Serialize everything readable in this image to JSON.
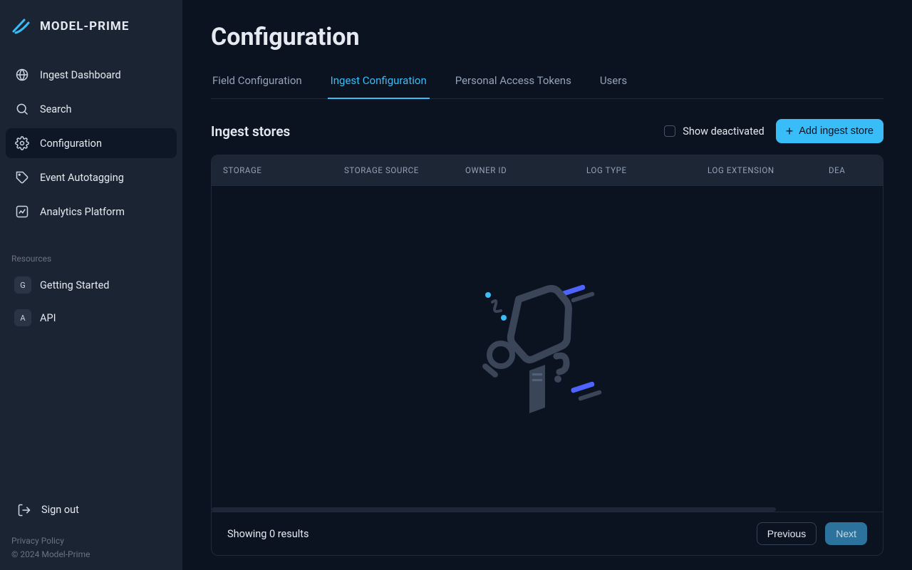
{
  "brand": {
    "name": "MODEL-PRIME"
  },
  "sidebar": {
    "items": [
      {
        "label": "Ingest Dashboard"
      },
      {
        "label": "Search"
      },
      {
        "label": "Configuration"
      },
      {
        "label": "Event Autotagging"
      },
      {
        "label": "Analytics Platform"
      }
    ],
    "resources_label": "Resources",
    "resources": [
      {
        "badge": "G",
        "label": "Getting Started"
      },
      {
        "badge": "A",
        "label": "API"
      }
    ],
    "signout": "Sign out",
    "legal_privacy": "Privacy Policy",
    "legal_copyright": "© 2024 Model-Prime"
  },
  "page": {
    "title": "Configuration"
  },
  "tabs": [
    {
      "label": "Field Configuration"
    },
    {
      "label": "Ingest Configuration"
    },
    {
      "label": "Personal Access Tokens"
    },
    {
      "label": "Users"
    }
  ],
  "section": {
    "title": "Ingest stores",
    "show_deactivated_label": "Show deactivated",
    "add_button_label": "Add ingest store"
  },
  "table": {
    "columns": {
      "storage": "STORAGE",
      "source": "STORAGE SOURCE",
      "owner": "OWNER ID",
      "logtype": "LOG TYPE",
      "logext": "LOG EXTENSION",
      "dea": "DEA"
    }
  },
  "footer": {
    "status": "Showing 0 results",
    "previous": "Previous",
    "next": "Next"
  }
}
